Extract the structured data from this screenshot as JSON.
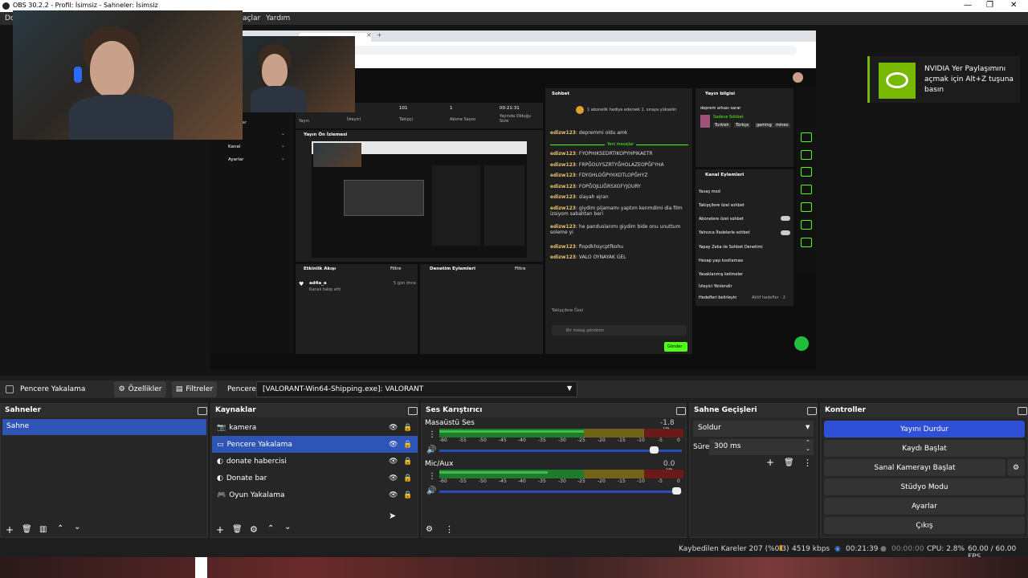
{
  "window": {
    "title": "OBS 30.2.2 - Profil: İsimsiz - Sahneler: İsimsiz",
    "minimize": "—",
    "maximize": "❐",
    "close": "✕"
  },
  "menu": {
    "items": [
      "Do",
      "açlar",
      "Yardım"
    ]
  },
  "preview": {
    "stream_stats": [
      {
        "value": "101",
        "label": "Takipçi"
      },
      {
        "value": "1",
        "label": "Abone Sayısı"
      },
      {
        "value": "00:21:31",
        "label": "Yayında Olduğu Süre"
      }
    ],
    "left_nav": {
      "top_label": "Yayın",
      "viewers_label": "İzleyici",
      "items": [
        "lar",
        "Kanal",
        "Ayarlar"
      ]
    },
    "stream_preview_title": "Yayın Ön İzlemesi",
    "activity": {
      "title": "Etkinlik Akışı",
      "filter": "Filtre",
      "user": "ad4a_a",
      "action": "Kanalı takip etti",
      "time": "5 gün önce"
    },
    "moderation": {
      "title": "Denetim Eylemleri",
      "filter": "Filtre"
    },
    "chat": {
      "title": "Sohbet",
      "notice": "1 abonelik hediye edersek 1. sıraya yükselin",
      "first_msg": {
        "user": "edizw123",
        "text": "depremmi oldu amk"
      },
      "new_messages": "Yeni mesajlar",
      "messages": [
        {
          "user": "edizw123",
          "text": "FYOPHIKSEDRTIKOPYHPIKAETR"
        },
        {
          "user": "edizw123",
          "text": "FRPĞOUYSZRTYĞHOLAZEOPĞFYHA"
        },
        {
          "user": "edizw123",
          "text": "FDYGHLOĞPYHXDTLOPĞHYZ"
        },
        {
          "user": "edizw123",
          "text": "FOPĞOJLUĞRSXOFYJOURY"
        },
        {
          "user": "edizw123",
          "text": "slayah ejran"
        },
        {
          "user": "edizw123",
          "text": "giydim pijamamı yaptım kenmdimi dia film izsiyom sabahtan beri"
        },
        {
          "user": "edizw123",
          "text": "he panduslarımı giydim bide onu unuttum soleme yi"
        },
        {
          "user": "edizw123",
          "text": "fiopdkhsycptfkohu"
        },
        {
          "user": "edizw123",
          "text": "VALO OYNAYAK GEL"
        }
      ],
      "followers_only": "Takipçilere Özel",
      "input_placeholder": "Bir mesaj gönderin",
      "send": "Gönder"
    },
    "stream_info": {
      "title": "Yayın bilgisi",
      "stream_title": "deprem arkası sarar",
      "category": "Sadece Sohbet",
      "tags": [
        "Turkish",
        "Türkçe",
        "gaming",
        "mineo"
      ]
    },
    "channel_actions": {
      "title": "Kanal Eylemleri",
      "items": [
        "Yavaş mod",
        "Takipçilere özel sohbet",
        "Abonelere özel sohbet",
        "Yalnızca İfadelerle sohbet",
        "Yapay Zeka ile Sohbet Denetimi",
        "Hesap yaşı kısıtlaması",
        "Yasaklanmış kelimeler",
        "İzleyici Yönlendir",
        "Hedefleri belirleyin"
      ],
      "goal_status": "Aktif hedefler - 2"
    },
    "browser": {
      "tab_close": "×",
      "tab_add": "+"
    }
  },
  "nvidia": {
    "line1": "NVIDIA Yer Paylaşımını",
    "line2": "açmak için Alt+Z tuşuna",
    "line3": "basın"
  },
  "toolbar": {
    "source_name": "Pencere Yakalama",
    "properties": "Özellikler",
    "filters": "Filtreler",
    "window_label": "Pencere",
    "window_value": "[VALORANT-Win64-Shipping.exe]: VALORANT"
  },
  "scenes": {
    "title": "Sahneler",
    "items": [
      "Sahne"
    ]
  },
  "sources": {
    "title": "Kaynaklar",
    "items": [
      "kamera",
      "Pencere Yakalama",
      "donate habercisi",
      "Donate bar",
      "Oyun Yakalama"
    ]
  },
  "mixer": {
    "title": "Ses Karıştırıcı",
    "channels": [
      {
        "name": "Masaüstü Ses",
        "db": "-1.8 dB",
        "volume": 0.88
      },
      {
        "name": "Mic/Aux",
        "db": "0.0 dB",
        "volume": 1.0
      }
    ],
    "scale": [
      "-60",
      "-55",
      "-50",
      "-45",
      "-40",
      "-35",
      "-30",
      "-25",
      "-20",
      "-15",
      "-10",
      "-5",
      "0"
    ]
  },
  "transitions": {
    "title": "Sahne Geçişleri",
    "type": "Soldur",
    "duration_label": "Süre",
    "duration_value": "300 ms"
  },
  "controls": {
    "title": "Kontroller",
    "buttons": [
      "Yayını Durdur",
      "Kaydı Başlat",
      "Sanal Kamerayı Başlat",
      "Stüdyo Modu",
      "Ayarlar",
      "Çıkış"
    ]
  },
  "status": {
    "dropped": "Kaybedilen Kareler 207 (%0.3)",
    "bitrate": "4519 kbps",
    "stream_time": "00:21:39",
    "rec_time": "00:00:00",
    "cpu": "CPU: 2.8%",
    "fps": "60.00 / 60.00 FPS"
  },
  "colors": {
    "accent": "#2e4fd6",
    "twitch_green": "#53fc18",
    "nvidia": "#76b900",
    "meter_green": "#3cbd4b",
    "meter_yellow": "#b8a12a",
    "meter_red": "#b32b2b"
  }
}
